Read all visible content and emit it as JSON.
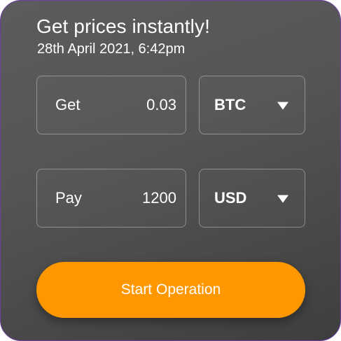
{
  "header": {
    "title": "Get prices instantly!",
    "timestamp": "28th April 2021, 6:42pm"
  },
  "get_row": {
    "label": "Get",
    "amount": "0.03",
    "currency": "BTC"
  },
  "pay_row": {
    "label": "Pay",
    "amount": "1200",
    "currency": "USD"
  },
  "action": {
    "button_label": "Start Operation"
  },
  "colors": {
    "accent": "#ff9800",
    "card_border": "#6a3fa0",
    "card_background": "#555556"
  },
  "icons": [
    "caret-down-icon"
  ]
}
